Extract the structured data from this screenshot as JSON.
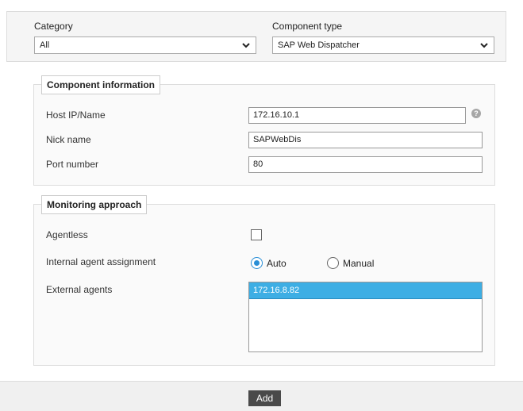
{
  "filters": {
    "category_label": "Category",
    "category_value": "All",
    "component_type_label": "Component type",
    "component_type_value": "SAP Web Dispatcher"
  },
  "component_info": {
    "legend": "Component information",
    "host_label": "Host IP/Name",
    "host_value": "172.16.10.1",
    "nick_label": "Nick name",
    "nick_value": "SAPWebDis",
    "port_label": "Port number",
    "port_value": "80",
    "help_glyph": "?"
  },
  "monitoring": {
    "legend": "Monitoring approach",
    "agentless_label": "Agentless",
    "agentless_checked": false,
    "assignment_label": "Internal agent assignment",
    "assignment_options": [
      "Auto",
      "Manual"
    ],
    "assignment_selected": "Auto",
    "external_label": "External agents",
    "external_agents": [
      "172.16.8.82"
    ],
    "external_selected": "172.16.8.82"
  },
  "footer": {
    "add_label": "Add"
  },
  "colors": {
    "accent": "#2a8fd6",
    "list_selected": "#3daee4",
    "button_bg": "#4a4a4a"
  },
  "icons": {
    "dropdown": "chevron-down-icon",
    "help": "help-icon"
  }
}
